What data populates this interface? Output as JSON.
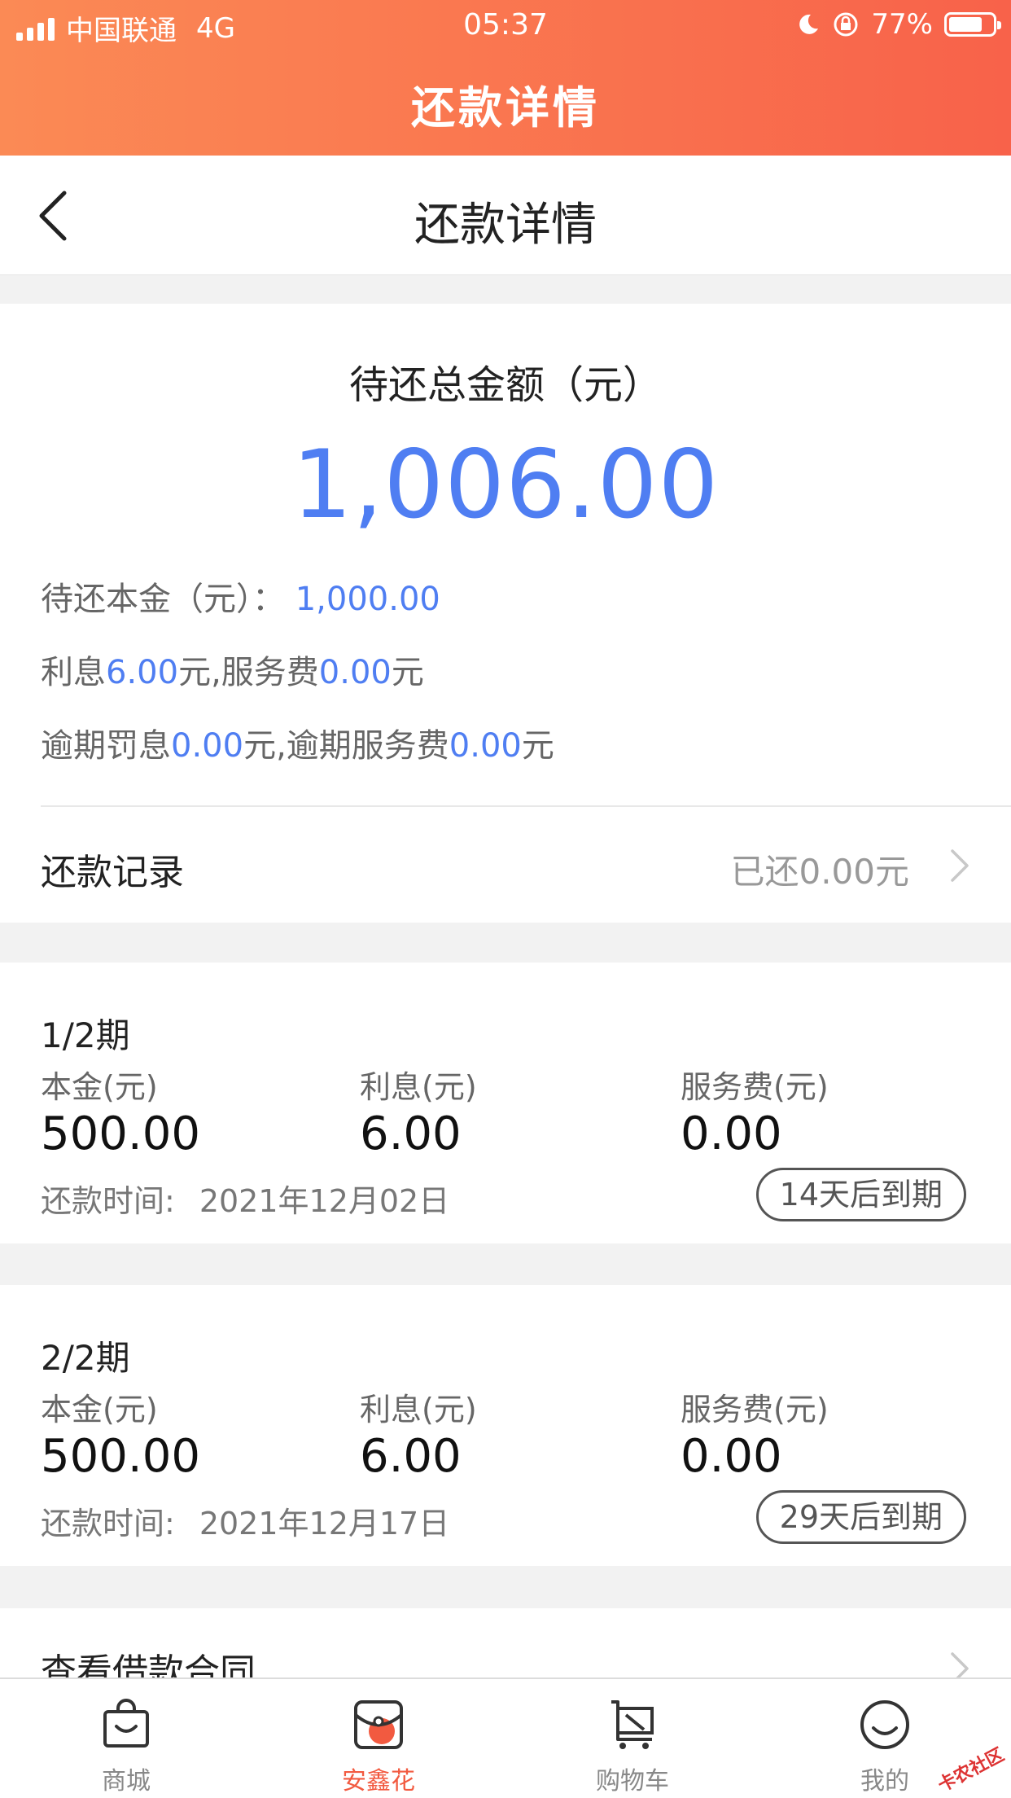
{
  "status_bar": {
    "carrier": "中国联通",
    "network": "4G",
    "time": "05:37",
    "battery": "77%",
    "battery_level": 0.77
  },
  "app_title": "还款详情",
  "nav": {
    "title": "还款详情",
    "back_icon": "chevron-left-icon"
  },
  "summary": {
    "total_label": "待还总金额（元）",
    "total_amount": "1,006.00",
    "principal_label": "待还本金（元）：",
    "principal_value": "1,000.00",
    "interest_label": "利息",
    "interest_value": "6.00",
    "yuan": "元",
    "service_label": ",服务费",
    "service_value": "0.00",
    "penalty_label": "逾期罚息",
    "penalty_value": "0.00",
    "overdue_service_label": ",逾期服务费",
    "overdue_service_value": "0.00"
  },
  "record": {
    "label": "还款记录",
    "value": "已还0.00元"
  },
  "periods": [
    {
      "title": "1/2期",
      "principal_label": "本金(元)",
      "principal": "500.00",
      "interest_label": "利息(元)",
      "interest": "6.00",
      "service_label": "服务费(元)",
      "service": "0.00",
      "due_label": "还款时间:",
      "due_date": "2021年12月02日",
      "badge": "14天后到期"
    },
    {
      "title": "2/2期",
      "principal_label": "本金(元)",
      "principal": "500.00",
      "interest_label": "利息(元)",
      "interest": "6.00",
      "service_label": "服务费(元)",
      "service": "0.00",
      "due_label": "还款时间:",
      "due_date": "2021年12月17日",
      "badge": "29天后到期"
    }
  ],
  "contract": {
    "label": "查看借款合同"
  },
  "tabs": [
    {
      "label": "商城",
      "icon": "shopping-bag-icon",
      "active": false
    },
    {
      "label": "安鑫花",
      "icon": "wallet-card-icon",
      "active": true
    },
    {
      "label": "购物车",
      "icon": "cart-icon",
      "active": false
    },
    {
      "label": "我的",
      "icon": "smiley-icon",
      "active": false
    }
  ],
  "watermark": "卡农社区",
  "colors": {
    "accent_blue": "#4f7ef2",
    "header_orange": "#f8624a",
    "active_tab": "#f25a40"
  }
}
